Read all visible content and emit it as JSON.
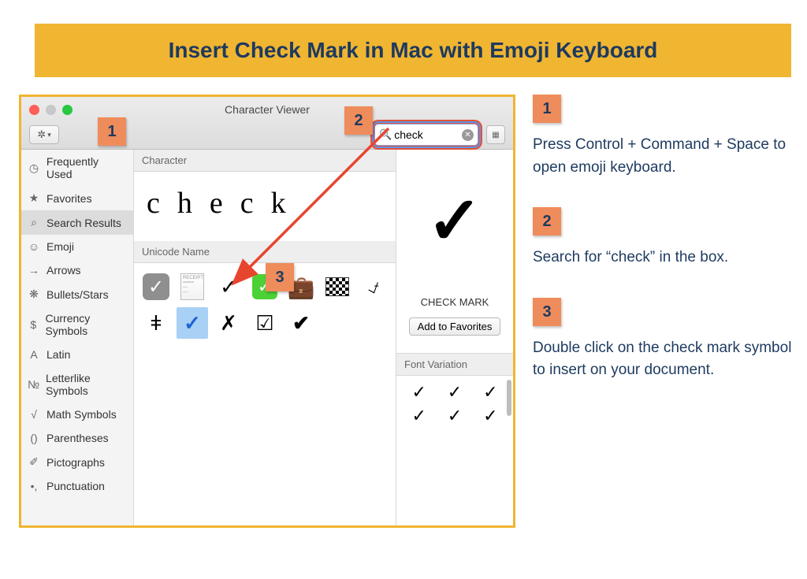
{
  "banner": {
    "title": "Insert Check Mark in Mac with Emoji Keyboard"
  },
  "window": {
    "title": "Character Viewer",
    "search_value": "check",
    "gear_label": "✽ ⌄"
  },
  "sidebar": {
    "items": [
      {
        "icon": "◷",
        "label": "Frequently Used"
      },
      {
        "icon": "★",
        "label": "Favorites"
      },
      {
        "icon": "⌕",
        "label": "Search Results",
        "selected": true
      },
      {
        "icon": "☺",
        "label": "Emoji"
      },
      {
        "icon": "→",
        "label": "Arrows"
      },
      {
        "icon": "❋",
        "label": "Bullets/Stars"
      },
      {
        "icon": "$",
        "label": "Currency Symbols"
      },
      {
        "icon": "A",
        "label": "Latin"
      },
      {
        "icon": "№",
        "label": "Letterlike Symbols"
      },
      {
        "icon": "√",
        "label": "Math Symbols"
      },
      {
        "icon": "()",
        "label": "Parentheses"
      },
      {
        "icon": "✐",
        "label": "Pictographs"
      },
      {
        "icon": "•,",
        "label": "Punctuation"
      }
    ]
  },
  "mid": {
    "character_header": "Character",
    "character_text": "check",
    "unicode_header": "Unicode Name",
    "unicode_cells": [
      "☑",
      "🧾",
      "✓",
      "✅",
      "💼",
      "🏁",
      "⍻",
      "ǂ",
      "✓",
      "✗",
      "☑",
      "✔"
    ],
    "selected_index": 8
  },
  "right": {
    "preview_char": "✓",
    "char_name": "CHECK MARK",
    "fav_button": "Add to Favorites",
    "fontvar_header": "Font Variation",
    "fontvar": [
      "✓",
      "✓",
      "✓",
      "✓",
      "✓",
      "✓"
    ]
  },
  "callouts": {
    "b1": "1",
    "b2": "2",
    "b3": "3"
  },
  "instructions": {
    "steps": [
      {
        "num": "1",
        "text": "Press Control + Command + Space to open emoji keyboard."
      },
      {
        "num": "2",
        "text": "Search for “check” in the box."
      },
      {
        "num": "3",
        "text": "Double click on the check mark symbol to insert on your document."
      }
    ]
  }
}
